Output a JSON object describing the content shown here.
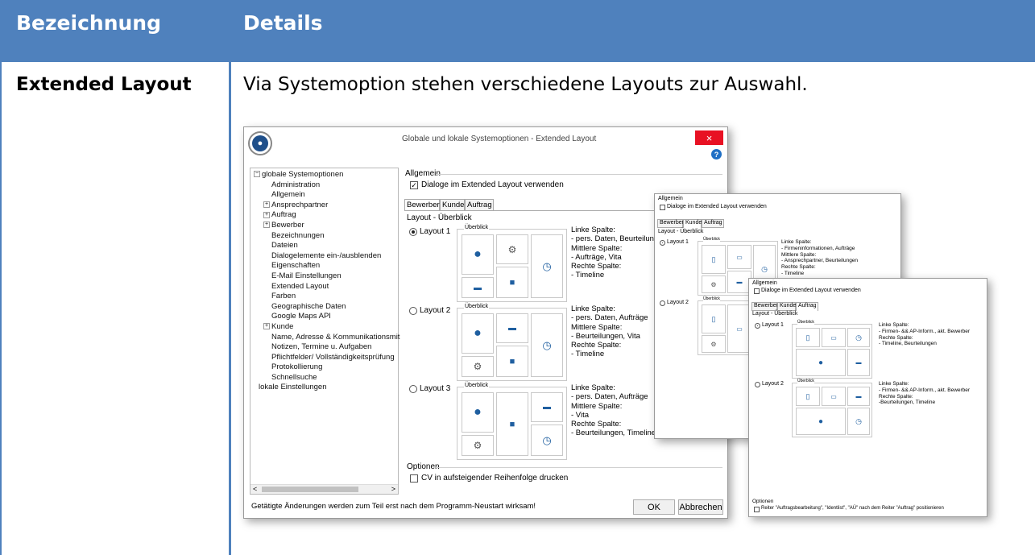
{
  "table": {
    "col1": "Bezeichnung",
    "col2": "Details",
    "row_label": "Extended Layout",
    "row_intro": "Via Systemoption stehen verschiedene Layouts zur Auswahl."
  },
  "dlg": {
    "title": "Globale und lokale Systemoptionen - Extended Layout",
    "close": "×",
    "help": "?",
    "tree": [
      "globale Systemoptionen",
      "Administration",
      "Allgemein",
      "Ansprechpartner",
      "Auftrag",
      "Bewerber",
      "Bezeichnungen",
      "Dateien",
      "Dialogelemente ein-/ausblenden",
      "Eigenschaften",
      "E-Mail Einstellungen",
      "Extended Layout",
      "Farben",
      "Geographische Daten",
      "Google Maps API",
      "Kunde",
      "Name, Adresse & Kommunikationsmit",
      "Notizen, Termine u. Aufgaben",
      "Pflichtfelder/ Vollständigkeitsprüfung",
      "Protokollierung",
      "Schnellsuche",
      "lokale Einstellungen"
    ],
    "allgemein": "Allgemein",
    "checkbox": "Dialoge im Extended Layout verwenden",
    "tabs": [
      "Bewerber",
      "Kunde",
      "Auftrag"
    ],
    "section": "Layout - Überblick",
    "overview": "Überblick",
    "layouts": [
      {
        "name": "Layout 1",
        "text": [
          "Linke Spalte:",
          "- pers. Daten, Beurteilungen",
          "Mittlere Spalte:",
          "- Aufträge, Vita",
          "Rechte Spalte:",
          "- Timeline"
        ]
      },
      {
        "name": "Layout 2",
        "text": [
          "Linke Spalte:",
          "- pers. Daten, Aufträge",
          "Mittlere Spalte:",
          "- Beurteilungen, Vita",
          "Rechte Spalte:",
          "- Timeline"
        ]
      },
      {
        "name": "Layout 3",
        "text": [
          "Linke Spalte:",
          "- pers. Daten, Aufträge",
          "Mittlere Spalte:",
          "- Vita",
          "Rechte Spalte:",
          "- Beurteilungen, Timeline"
        ]
      }
    ],
    "optionen": "Optionen",
    "cv": "CV in aufsteigender Reihenfolge drucken",
    "footer": "Getätigte Änderungen werden zum Teil erst nach dem Programm-Neustart wirksam!",
    "ok": "OK",
    "cancel": "Abbrechen",
    "scroll_left": "<",
    "scroll_right": ">"
  },
  "kunde": {
    "allgemein": "Allgemein",
    "checkbox": "Dialoge im Extended Layout verwenden",
    "tabs": [
      "Bewerber",
      "Kunde",
      "Auftrag"
    ],
    "section": "Layout - Überblick",
    "overview": "Überblick",
    "l1": "Layout 1",
    "l2": "Layout 2",
    "text": [
      "Linke Spalte:",
      "- Firmeninformationen, Aufträge",
      "Mittlere Spalte:",
      "- Ansprechpartner, Beurteilungen",
      "Rechte Spalte:",
      "- Timeline"
    ]
  },
  "auftrag": {
    "allgemein": "Allgemein",
    "checkbox": "Dialoge im Extended Layout verwenden",
    "tabs": [
      "Bewerber",
      "Kunde",
      "Auftrag"
    ],
    "section": "Layout - Überblick",
    "overview": "Überblick",
    "l1": "Layout 1",
    "l2": "Layout 2",
    "text1": [
      "Linke Spalte:",
      "- Firmen- && AP-Inform., akt. Bewerber",
      "Rechte Spalte:",
      "- Timeline, Beurteilungen"
    ],
    "text2": [
      "Linke Spalte:",
      "- Firmen- && AP-Inform., akt. Bewerber",
      "Rechte Spalte:",
      "-Beurteilungen, Timeline"
    ],
    "optionen": "Optionen",
    "checkbox2": "Reiter \"Auftragsbearbeitung\", \"Identlist\", \"AÜ\" nach dem Reiter \"Auftrag\" positionieren"
  },
  "colors": {
    "header": "#4f81bd",
    "close": "#e81123",
    "icon": "#1f5fa0"
  }
}
